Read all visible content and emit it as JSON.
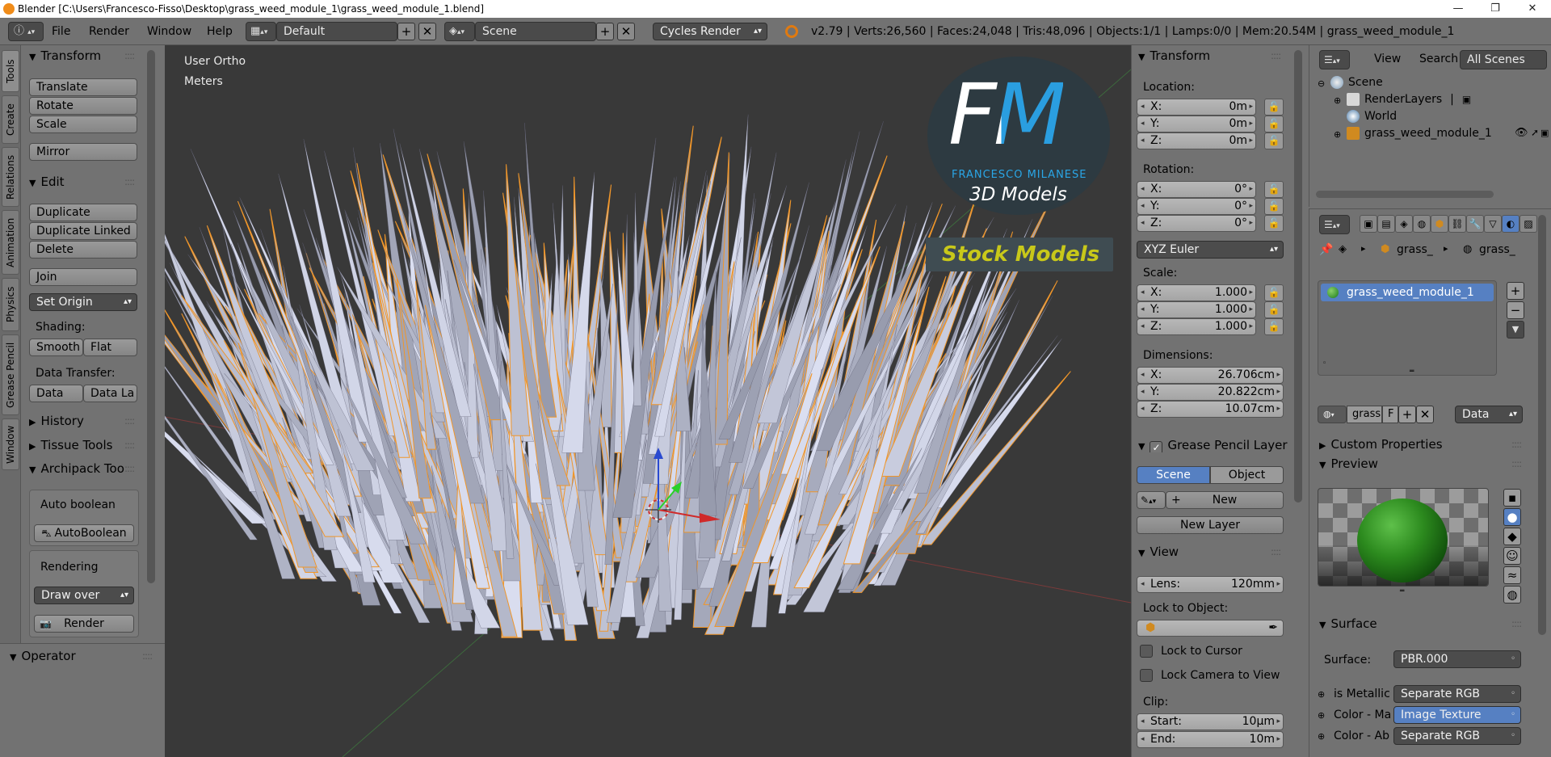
{
  "title_bar": {
    "text": "Blender [C:\\Users\\Francesco-Fisso\\Desktop\\grass_weed_module_1\\grass_weed_module_1.blend]"
  },
  "menu": {
    "items": [
      "File",
      "Render",
      "Window",
      "Help"
    ],
    "layout": "Default",
    "scene": "Scene",
    "engine": "Cycles Render",
    "stats": "v2.79 | Verts:26,560 | Faces:24,048 | Tris:48,096 | Objects:1/1 | Lamps:0/0 | Mem:20.54M | grass_weed_module_1"
  },
  "left_tabs": [
    "Tools",
    "Create",
    "Relations",
    "Animation",
    "Physics",
    "Grease Pencil",
    "Window"
  ],
  "toolshelf": {
    "transform": {
      "title": "Transform",
      "buttons": [
        "Translate",
        "Rotate",
        "Scale",
        "Mirror"
      ]
    },
    "edit": {
      "title": "Edit",
      "buttons": [
        "Duplicate",
        "Duplicate Linked",
        "Delete",
        "Join"
      ],
      "set_origin": "Set Origin",
      "shading_label": "Shading:",
      "smooth": "Smooth",
      "flat": "Flat",
      "data_transfer_label": "Data Transfer:",
      "data": "Data",
      "data_la": "Data La"
    },
    "history": "History",
    "tissue": "Tissue Tools",
    "archipack": {
      "title": "Archipack Tools",
      "auto_boolean_label": "Auto boolean",
      "auto_boolean_btn": "AutoBoolean",
      "rendering_label": "Rendering",
      "draw_over": "Draw over",
      "render": "Render"
    },
    "operator": "Operator"
  },
  "viewport": {
    "view_name": "User Ortho",
    "units": "Meters",
    "watermark": {
      "initials": "FM",
      "name": "FRANCESCO MILANESE",
      "sub": "3D Models",
      "stock": "Stock Models"
    }
  },
  "npanel": {
    "transform_title": "Transform",
    "location_label": "Location:",
    "location": [
      {
        "k": "X:",
        "v": "0m"
      },
      {
        "k": "Y:",
        "v": "0m"
      },
      {
        "k": "Z:",
        "v": "0m"
      }
    ],
    "rotation_label": "Rotation:",
    "rotation": [
      {
        "k": "X:",
        "v": "0°"
      },
      {
        "k": "Y:",
        "v": "0°"
      },
      {
        "k": "Z:",
        "v": "0°"
      }
    ],
    "rotation_mode": "XYZ Euler",
    "scale_label": "Scale:",
    "scale": [
      {
        "k": "X:",
        "v": "1.000"
      },
      {
        "k": "Y:",
        "v": "1.000"
      },
      {
        "k": "Z:",
        "v": "1.000"
      }
    ],
    "dimensions_label": "Dimensions:",
    "dimensions": [
      {
        "k": "X:",
        "v": "26.706cm"
      },
      {
        "k": "Y:",
        "v": "20.822cm"
      },
      {
        "k": "Z:",
        "v": "10.07cm"
      }
    ],
    "grease_title": "Grease Pencil Layer",
    "scene_btn": "Scene",
    "object_btn": "Object",
    "new_btn": "New",
    "new_layer": "New Layer",
    "view_title": "View",
    "lens_label": "Lens:",
    "lens_value": "120mm",
    "lock_object_label": "Lock to Object:",
    "lock_cursor": "Lock to Cursor",
    "lock_camera": "Lock Camera to View",
    "clip_label": "Clip:",
    "clip_start_label": "Start:",
    "clip_start": "10µm",
    "clip_end_label": "End:",
    "clip_end": "10m"
  },
  "outliner": {
    "view": "View",
    "search": "Search",
    "filter": "All Scenes",
    "items": [
      "Scene",
      "RenderLayers",
      "World",
      "grass_weed_module_1"
    ]
  },
  "properties": {
    "breadcrumb": [
      "grass_",
      "grass_"
    ],
    "material_slot": "grass_weed_module_1",
    "mat_name": "grass",
    "mat_f": "F",
    "link": "Data",
    "custom_properties": "Custom Properties",
    "preview": "Preview",
    "surface_title": "Surface",
    "surface_label": "Surface:",
    "surface_value": "PBR.000",
    "rows": [
      {
        "label": "is Metallic",
        "value": "Separate RGB"
      },
      {
        "label": "Color - Ma",
        "value": "Image Texture"
      },
      {
        "label": "Color - Ab",
        "value": "Separate RGB"
      }
    ]
  },
  "colors": {
    "selected_blue": "#5680c2",
    "outline_orange": "#f0962a",
    "grass": "#b4b8c8"
  }
}
